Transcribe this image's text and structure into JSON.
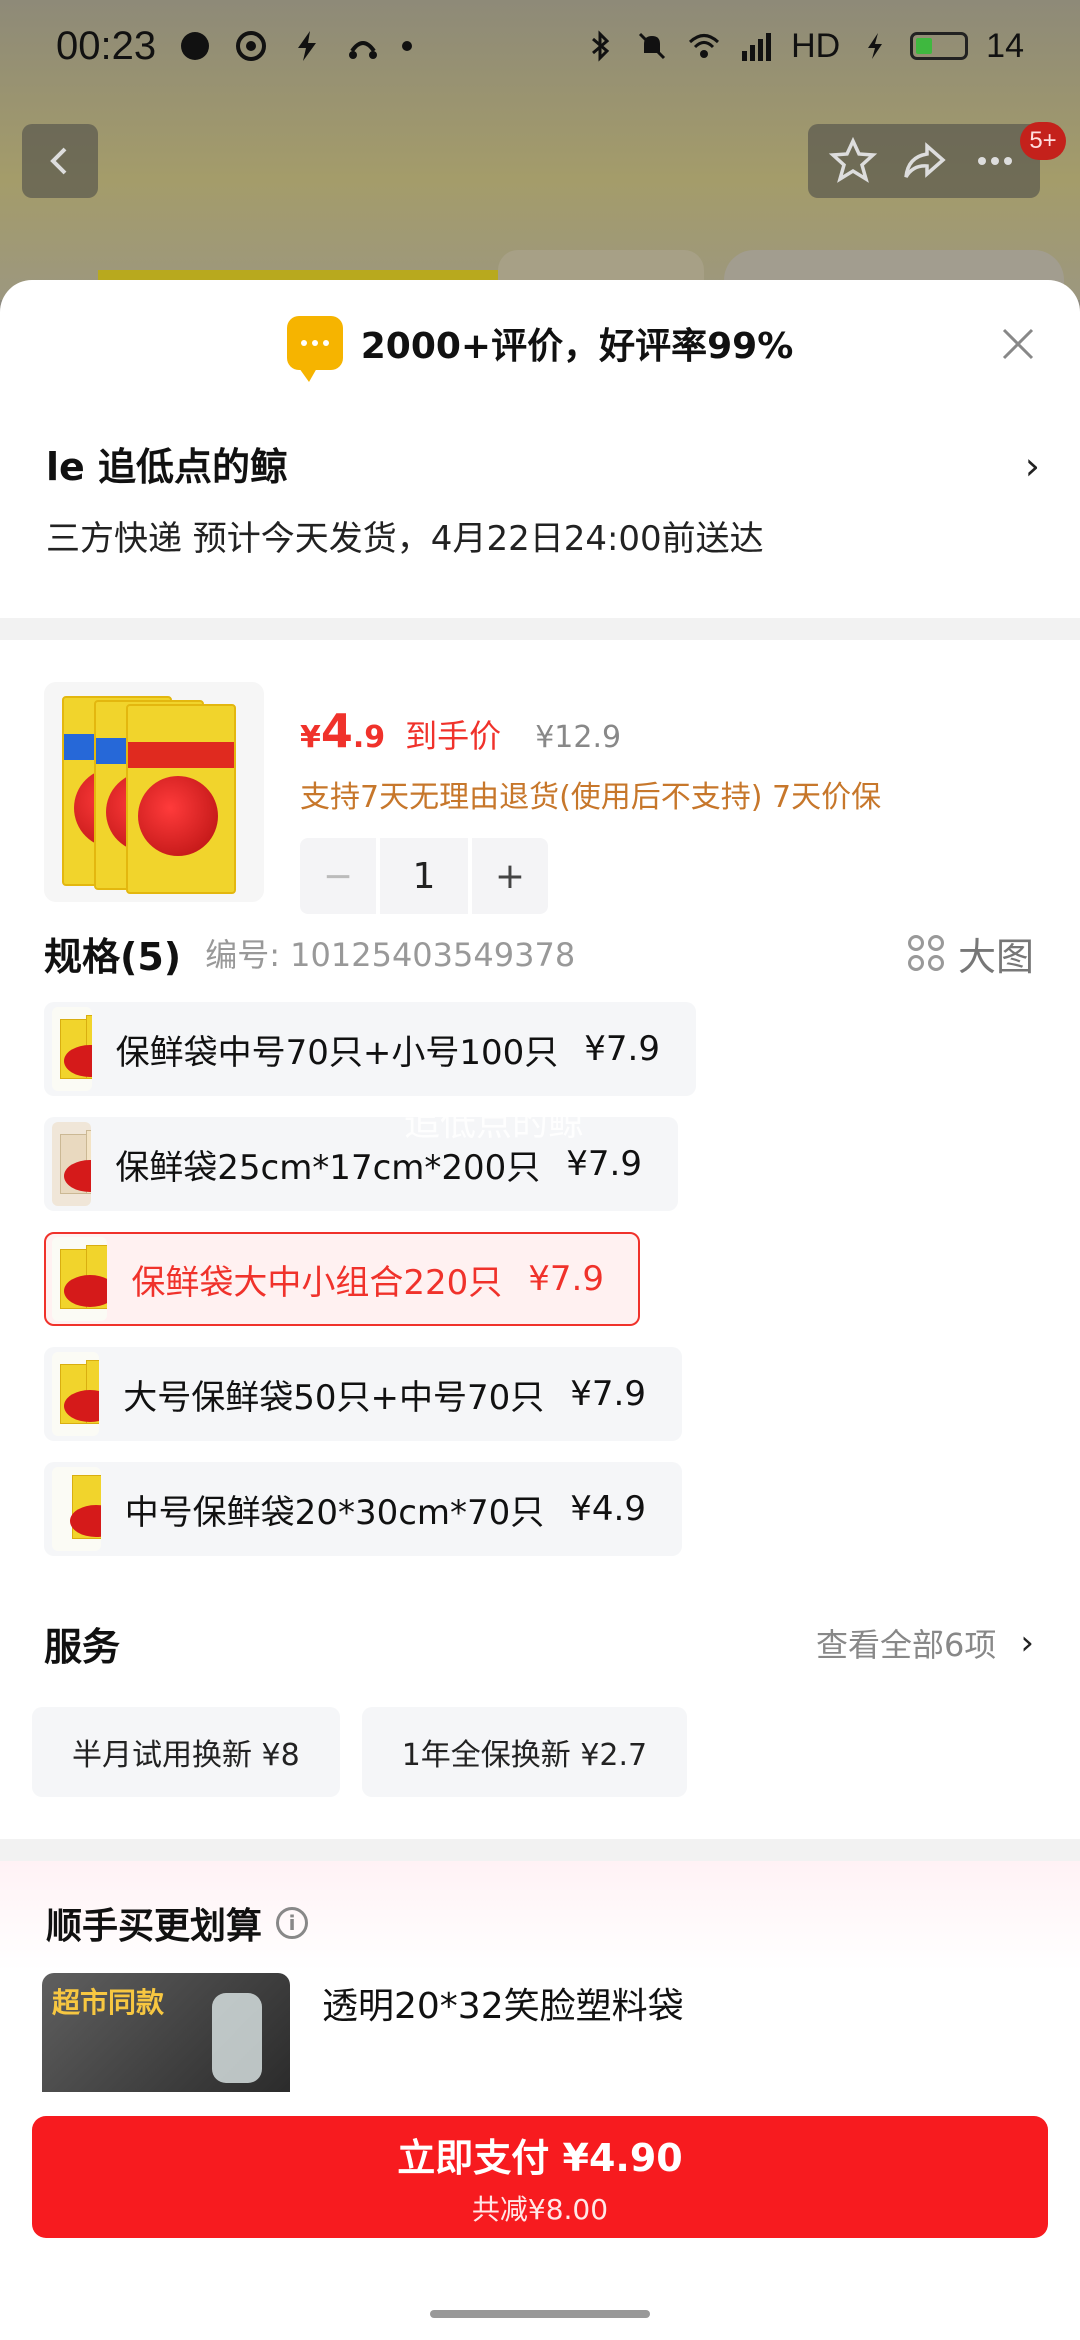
{
  "status_bar": {
    "time": "00:23",
    "network": "HD",
    "battery": "14"
  },
  "header_badge": "5+",
  "sheet": {
    "rating_text": "2000+评价，好评率99%",
    "address": {
      "title": "le  追低点的鲸",
      "delivery": "三方快递 预计今天发货，4月22日24:00前送达"
    },
    "product": {
      "price_symbol": "¥",
      "price_int": "4",
      "price_dec": ".9",
      "price_label": "到手价",
      "original_price": "¥12.9",
      "guarantee": "支持7天无理由退货(使用后不支持) 7天价保",
      "quantity": "1",
      "minus": "−",
      "plus": "+"
    },
    "spec": {
      "title": "规格(5)",
      "code": "编号: 10125403549378",
      "big_picture": "大图",
      "items": [
        {
          "name": "保鲜袋中号70只+小号100只",
          "price": "¥7.9"
        },
        {
          "name": "保鲜袋25cm*17cm*200只",
          "price": "¥7.9"
        },
        {
          "name": "保鲜袋大中小组合220只",
          "price": "¥7.9",
          "selected": true
        },
        {
          "name": "大号保鲜袋50只+中号70只",
          "price": "¥7.9"
        },
        {
          "name": "中号保鲜袋20*30cm*70只",
          "price": "¥4.9"
        }
      ]
    },
    "watermark": "追低点的鲸",
    "service": {
      "title": "服务",
      "view_all": "查看全部6项",
      "chips": [
        "半月试用换新  ¥8",
        "1年全保换新  ¥2.7"
      ]
    },
    "addon": {
      "title": "顺手买更划算",
      "tag": "超市同款",
      "item_name": "透明20*32笑脸塑料袋"
    }
  },
  "footer": {
    "pay_label": "立即支付 ¥4.90",
    "discount": "共减¥8.00"
  },
  "colors": {
    "accent": "#f71b1f",
    "price_red": "#f0322b",
    "guarantee": "#c7772b",
    "rating_icon": "#f6b400"
  }
}
